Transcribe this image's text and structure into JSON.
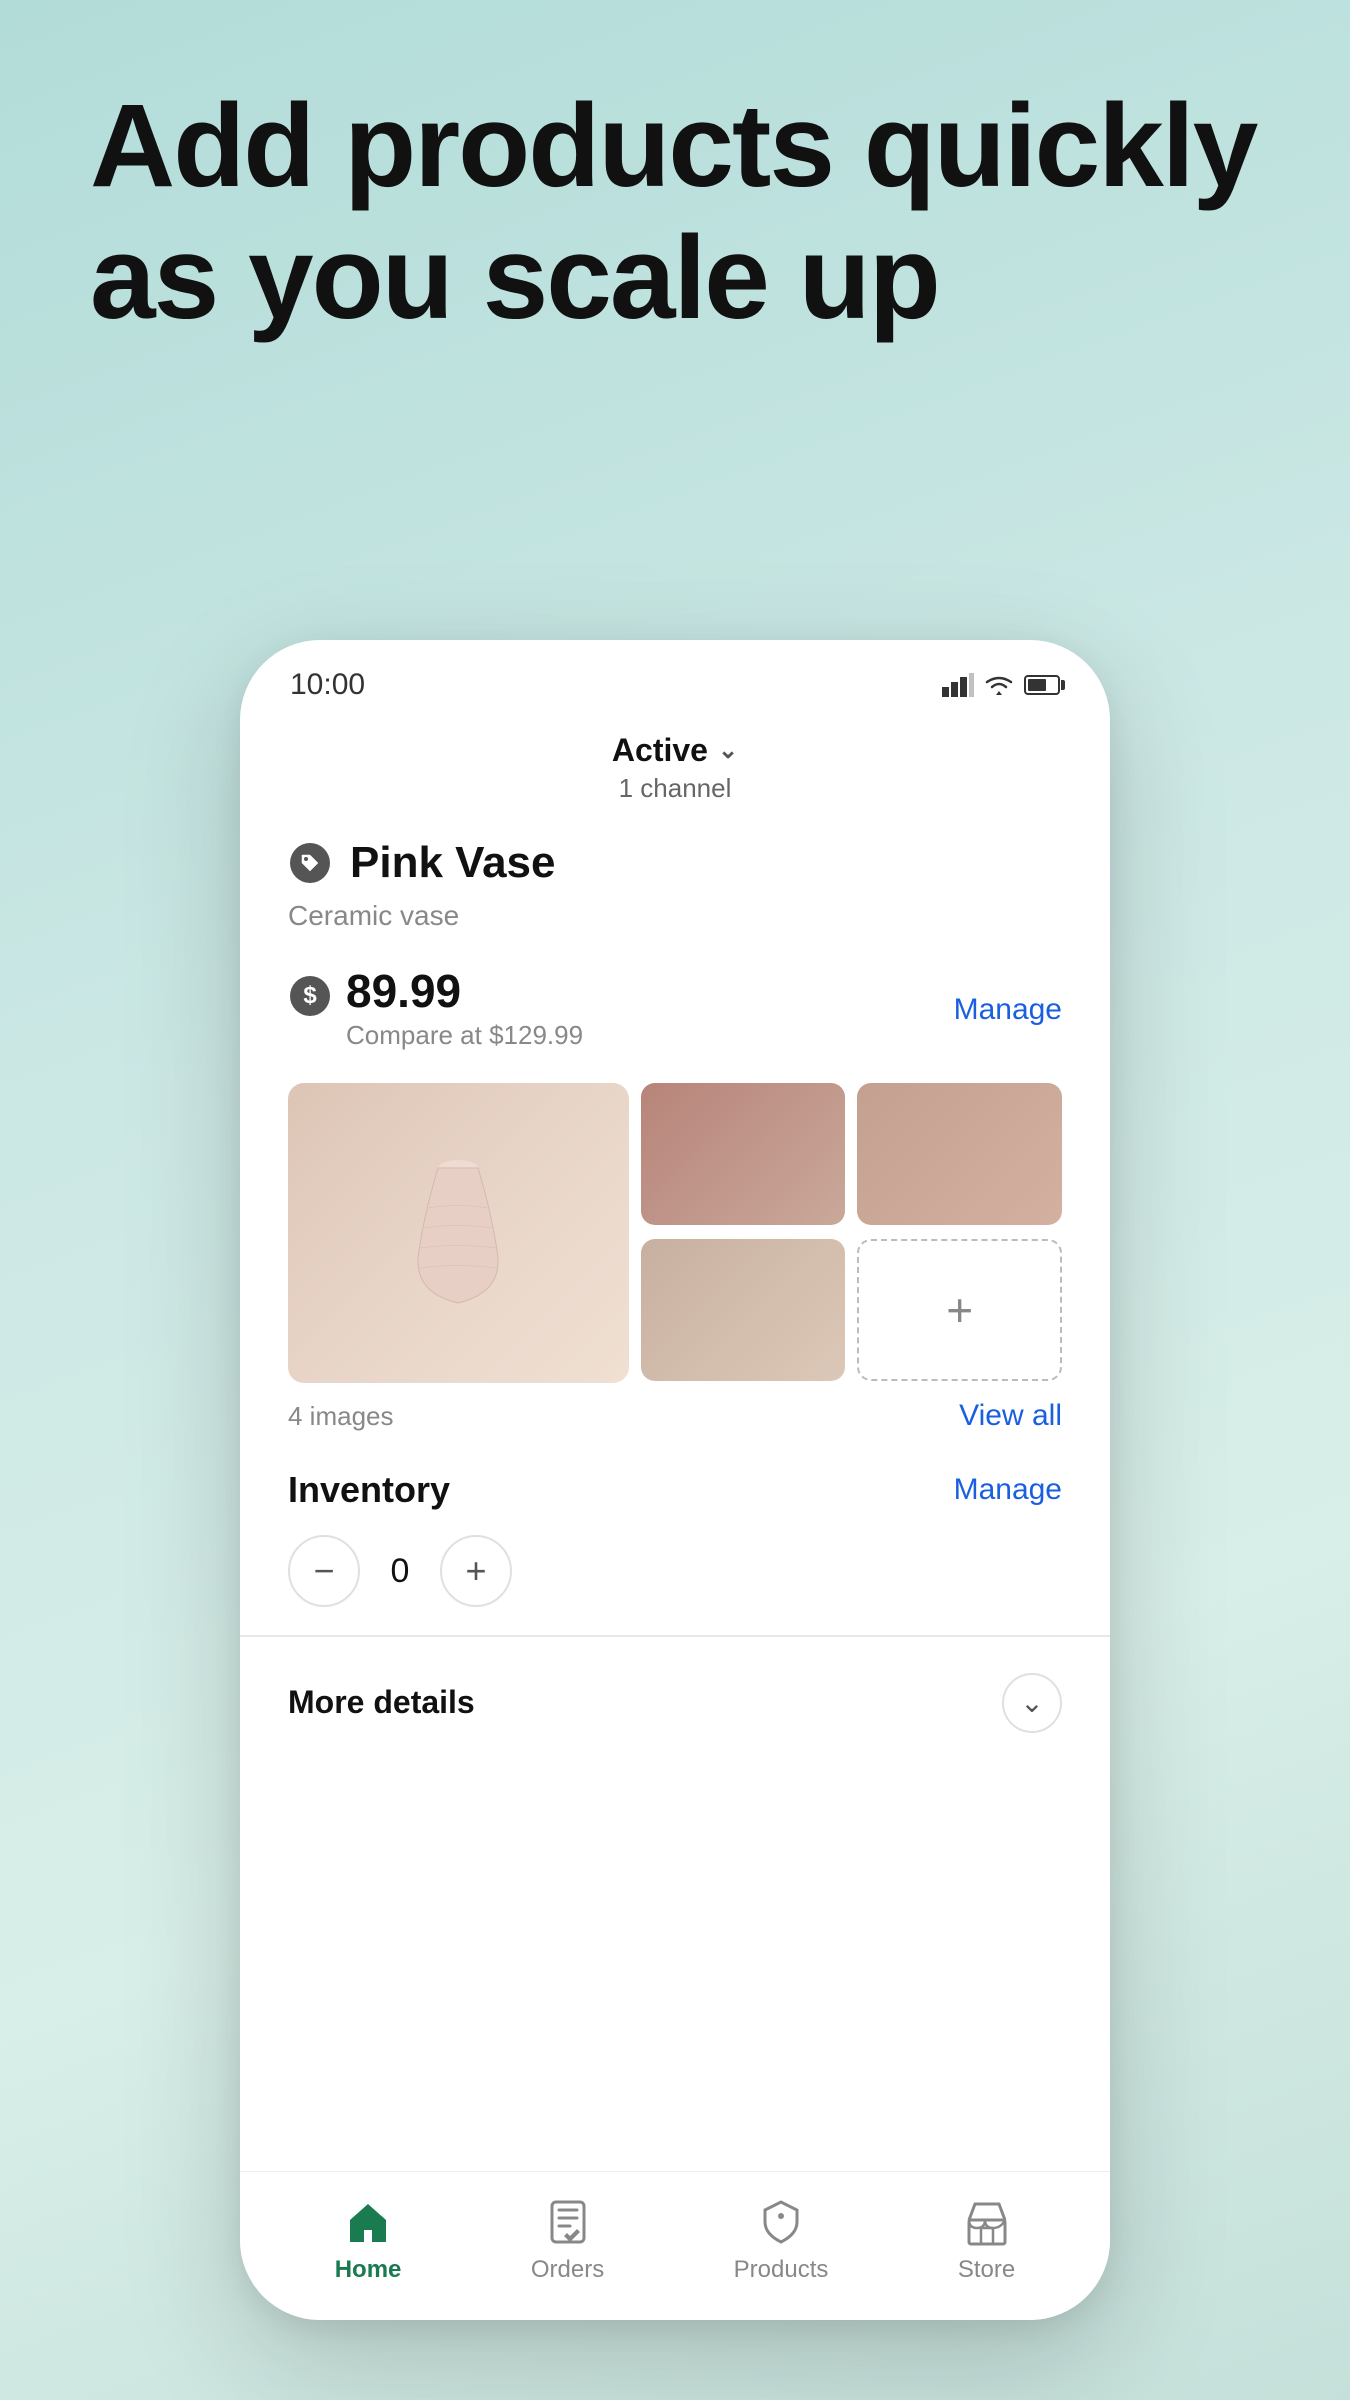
{
  "hero": {
    "title": "Add products quickly as you scale up"
  },
  "phone": {
    "statusBar": {
      "time": "10:00",
      "icons": [
        "signal",
        "wifi",
        "battery"
      ]
    },
    "activeHeader": {
      "status": "Active",
      "channelLabel": "1 channel"
    },
    "product": {
      "name": "Pink Vase",
      "description": "Ceramic vase",
      "price": "89.99",
      "compareAt": "Compare at $129.99",
      "manageLabel": "Manage",
      "imagesCount": "4 images",
      "viewAllLabel": "View all"
    },
    "inventory": {
      "title": "Inventory",
      "manageLabel": "Manage",
      "quantity": "0",
      "minusLabel": "−",
      "plusLabel": "+"
    },
    "moreDetails": {
      "label": "More details"
    },
    "bottomNav": [
      {
        "id": "home",
        "label": "Home",
        "active": true
      },
      {
        "id": "orders",
        "label": "Orders",
        "active": false
      },
      {
        "id": "products",
        "label": "Products",
        "active": false
      },
      {
        "id": "store",
        "label": "Store",
        "active": false
      }
    ]
  }
}
